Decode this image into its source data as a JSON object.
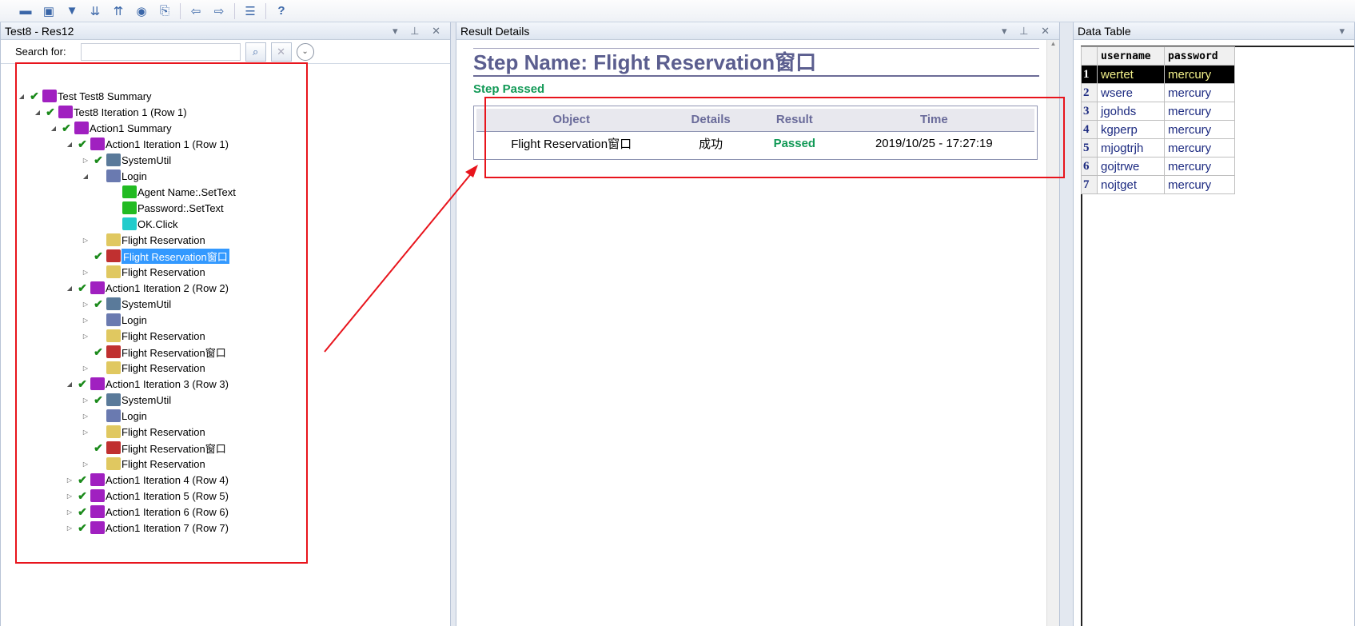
{
  "toolbar": {
    "icons": [
      "open-icon",
      "print-icon",
      "filter-icon",
      "expand-icon",
      "collapse-icon",
      "refresh-icon",
      "export-icon",
      "back-icon",
      "forward-icon",
      "list-icon",
      "help-icon"
    ]
  },
  "left_panel": {
    "title": "Test8 - Res12",
    "search_label": "Search for:",
    "search_value": "",
    "tree": [
      {
        "level": 0,
        "label": "Test Test8 Summary",
        "twisty": "open",
        "check": true,
        "icon": "#a020c0"
      },
      {
        "level": 1,
        "label": "Test8 Iteration 1 (Row 1)",
        "twisty": "open",
        "check": true,
        "icon": "#a020c0"
      },
      {
        "level": 2,
        "label": "Action1 Summary",
        "twisty": "open",
        "check": true,
        "icon": "#a020c0"
      },
      {
        "level": 3,
        "label": "Action1 Iteration 1 (Row 1)",
        "twisty": "open",
        "check": true,
        "icon": "#a020c0"
      },
      {
        "level": 4,
        "label": "SystemUtil",
        "twisty": "closed",
        "check": true,
        "icon": "#5a7a9a"
      },
      {
        "level": 4,
        "label": "Login",
        "twisty": "open",
        "check": false,
        "icon": "#6a7ab0"
      },
      {
        "level": 5,
        "label": "Agent Name:.SetText",
        "twisty": "",
        "check": false,
        "icon": "#22bb22"
      },
      {
        "level": 5,
        "label": "Password:.SetText",
        "twisty": "",
        "check": false,
        "icon": "#22bb22"
      },
      {
        "level": 5,
        "label": "OK.Click",
        "twisty": "",
        "check": false,
        "icon": "#22cccc"
      },
      {
        "level": 4,
        "label": "Flight Reservation",
        "twisty": "closed",
        "check": false,
        "icon": "#e0c860"
      },
      {
        "level": 4,
        "label": "Flight Reservation窗口",
        "twisty": "",
        "check": true,
        "icon": "#c03030",
        "selected": true
      },
      {
        "level": 4,
        "label": "Flight Reservation",
        "twisty": "closed",
        "check": false,
        "icon": "#e0c860"
      },
      {
        "level": 3,
        "label": "Action1 Iteration 2 (Row 2)",
        "twisty": "open",
        "check": true,
        "icon": "#a020c0"
      },
      {
        "level": 4,
        "label": "SystemUtil",
        "twisty": "closed",
        "check": true,
        "icon": "#5a7a9a"
      },
      {
        "level": 4,
        "label": "Login",
        "twisty": "closed",
        "check": false,
        "icon": "#6a7ab0"
      },
      {
        "level": 4,
        "label": "Flight Reservation",
        "twisty": "closed",
        "check": false,
        "icon": "#e0c860"
      },
      {
        "level": 4,
        "label": "Flight Reservation窗口",
        "twisty": "",
        "check": true,
        "icon": "#c03030"
      },
      {
        "level": 4,
        "label": "Flight Reservation",
        "twisty": "closed",
        "check": false,
        "icon": "#e0c860"
      },
      {
        "level": 3,
        "label": "Action1 Iteration 3 (Row 3)",
        "twisty": "open",
        "check": true,
        "icon": "#a020c0"
      },
      {
        "level": 4,
        "label": "SystemUtil",
        "twisty": "closed",
        "check": true,
        "icon": "#5a7a9a"
      },
      {
        "level": 4,
        "label": "Login",
        "twisty": "closed",
        "check": false,
        "icon": "#6a7ab0"
      },
      {
        "level": 4,
        "label": "Flight Reservation",
        "twisty": "closed",
        "check": false,
        "icon": "#e0c860"
      },
      {
        "level": 4,
        "label": "Flight Reservation窗口",
        "twisty": "",
        "check": true,
        "icon": "#c03030"
      },
      {
        "level": 4,
        "label": "Flight Reservation",
        "twisty": "closed",
        "check": false,
        "icon": "#e0c860"
      },
      {
        "level": 3,
        "label": "Action1 Iteration 4 (Row 4)",
        "twisty": "closed",
        "check": true,
        "icon": "#a020c0"
      },
      {
        "level": 3,
        "label": "Action1 Iteration 5 (Row 5)",
        "twisty": "closed",
        "check": true,
        "icon": "#a020c0"
      },
      {
        "level": 3,
        "label": "Action1 Iteration 6 (Row 6)",
        "twisty": "closed",
        "check": true,
        "icon": "#a020c0"
      },
      {
        "level": 3,
        "label": "Action1 Iteration 7 (Row 7)",
        "twisty": "closed",
        "check": true,
        "icon": "#a020c0"
      }
    ]
  },
  "result_panel": {
    "title": "Result Details",
    "step_name": "Step Name: Flight Reservation窗口",
    "status": "Step Passed",
    "columns": [
      "Object",
      "Details",
      "Result",
      "Time"
    ],
    "row": {
      "object": "Flight Reservation窗口",
      "details": "成功",
      "result": "Passed",
      "time": "2019/10/25 - 17:27:19"
    }
  },
  "data_table": {
    "title": "Data Table",
    "columns": [
      "username",
      "password"
    ],
    "rows": [
      [
        "1",
        "wertet",
        "mercury"
      ],
      [
        "2",
        "wsere",
        "mercury"
      ],
      [
        "3",
        "jgohds",
        "mercury"
      ],
      [
        "4",
        "kgperp",
        "mercury"
      ],
      [
        "5",
        "mjogtrjh",
        "mercury"
      ],
      [
        "6",
        "gojtrwe",
        "mercury"
      ],
      [
        "7",
        "nojtget",
        "mercury"
      ]
    ]
  },
  "colors": {
    "annotation": "#e8141c",
    "passed": "#119956",
    "selection": "#3399ff"
  }
}
